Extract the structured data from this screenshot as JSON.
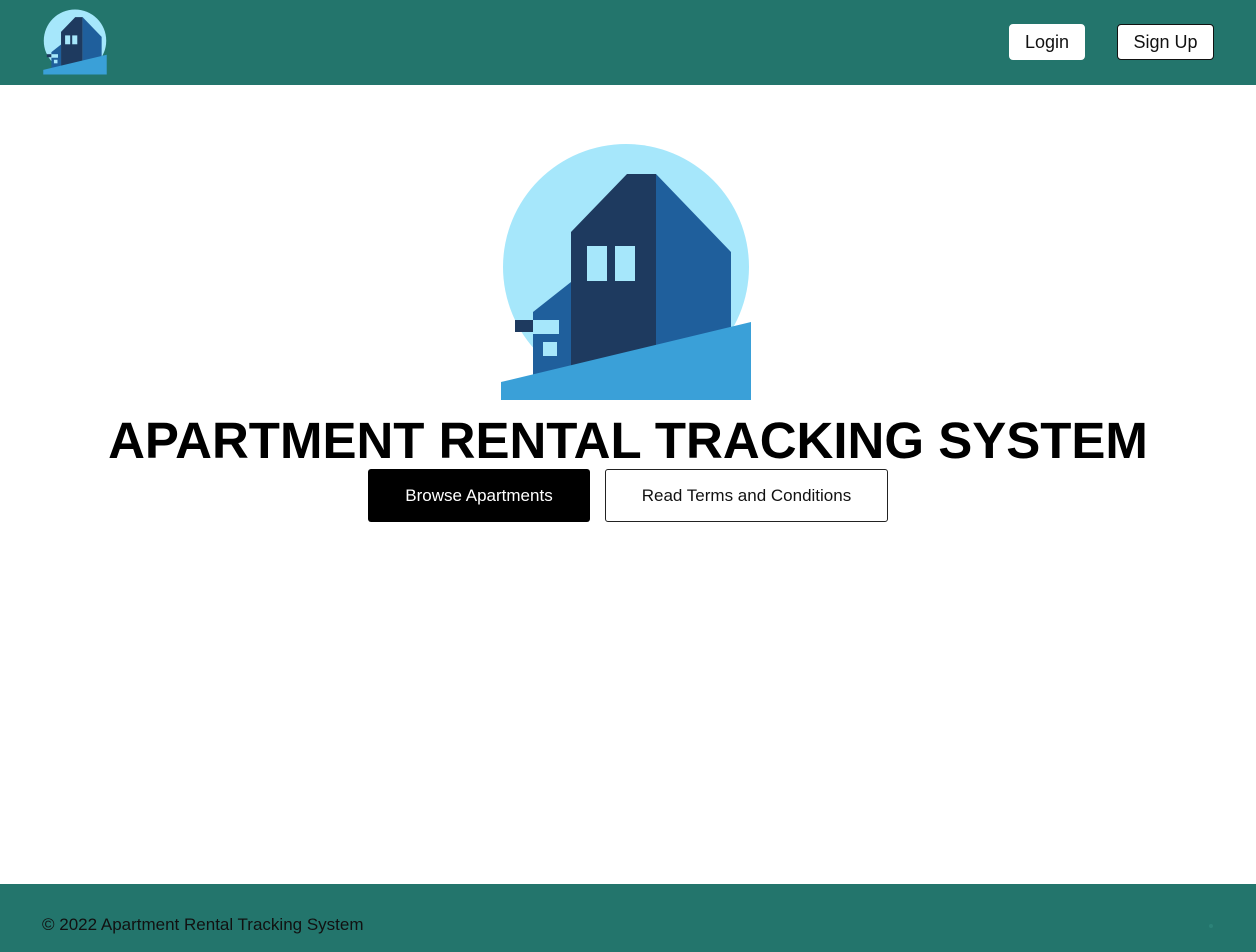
{
  "header": {
    "logo_icon": "apartment-building-logo-icon",
    "login_label": "Login",
    "signup_label": "Sign Up"
  },
  "hero": {
    "logo_icon": "apartment-building-logo-icon",
    "title": "APARTMENT RENTAL TRACKING SYSTEM",
    "browse_label": "Browse Apartments",
    "terms_label": "Read Terms and Conditions"
  },
  "footer": {
    "copyright": "© 2022 Apartment Rental Tracking System"
  },
  "colors": {
    "header_bg": "#23756c",
    "footer_bg": "#23756c",
    "primary_button_bg": "#000000",
    "logo_circle": "#a6e7fb",
    "logo_dark_blue": "#1e3a5f",
    "logo_mid_blue": "#1f5f9c",
    "logo_light_blue": "#3aa0d8"
  }
}
